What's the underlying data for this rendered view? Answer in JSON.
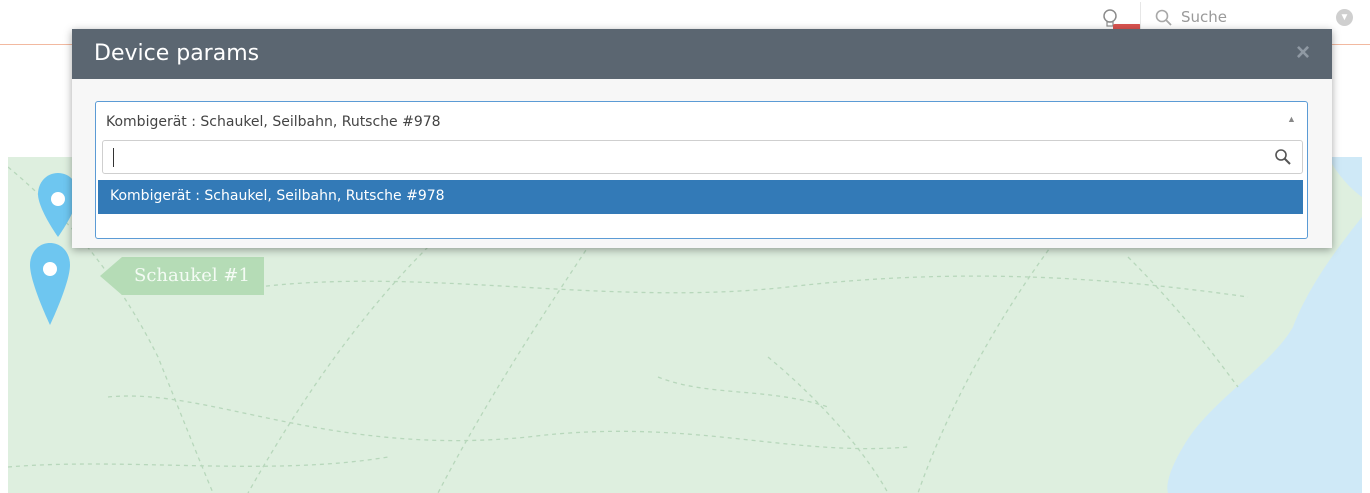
{
  "topbar": {
    "search_placeholder": "Suche",
    "icons": {
      "bulb": "lightbulb-icon",
      "search": "search-icon",
      "dropdown": "chevron-down-icon"
    },
    "accent_color": "#f2b9a0"
  },
  "map": {
    "label": "Schaukel #1",
    "pin_color": "#6ec6f0",
    "land_color": "#deefdf",
    "water_color": "#cfe9f7"
  },
  "modal": {
    "title": "Device params",
    "close_label": "×",
    "header_color": "#5b6671",
    "select": {
      "selected_value": "Kombigerät : Schaukel, Seilbahn, Rutsche #978",
      "search_value": "",
      "options": [
        {
          "label": "Kombigerät : Schaukel, Seilbahn, Rutsche #978",
          "highlighted": true
        }
      ],
      "highlight_color": "#337ab7"
    }
  }
}
